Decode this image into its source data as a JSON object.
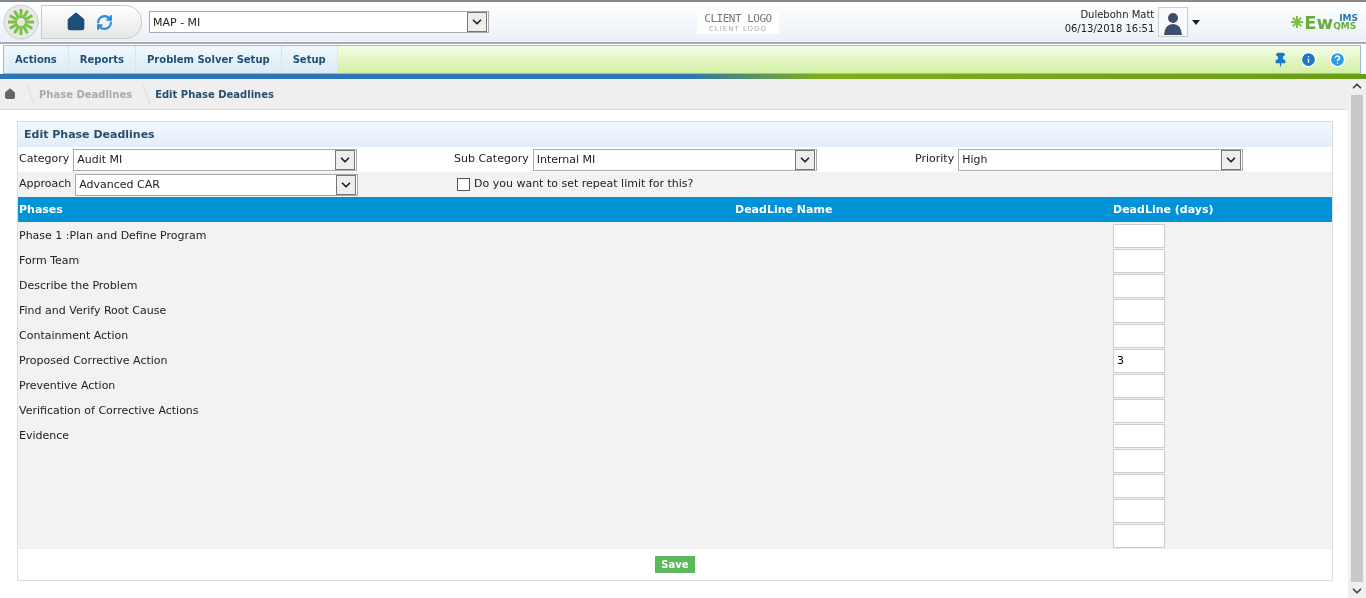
{
  "header": {
    "module_select": {
      "value": "MAP - MI"
    },
    "client_logo": {
      "title": "CLIENT LOGO",
      "subtitle": "CLIENT LOGO"
    },
    "user": {
      "name": "Dulebohn Matt",
      "datetime": "06/13/2018 16:51"
    },
    "brand": {
      "main": "Ew",
      "sub": "QMS",
      "sup": "IMS"
    }
  },
  "menu": [
    {
      "label": "Actions"
    },
    {
      "label": "Reports"
    },
    {
      "label": "Problem Solver Setup"
    },
    {
      "label": "Setup"
    }
  ],
  "breadcrumb": [
    {
      "label": "Phase Deadlines",
      "selected": false
    },
    {
      "label": "Edit Phase Deadlines",
      "selected": true
    }
  ],
  "panel": {
    "title": "Edit Phase Deadlines",
    "filters": [
      {
        "label": "Category",
        "value": "Audit MI"
      },
      {
        "label": "Sub Category",
        "value": "Internal MI"
      },
      {
        "label": "Priority",
        "value": "High"
      },
      {
        "label": "Approach",
        "value": "Advanced CAR"
      }
    ],
    "repeat_limit": {
      "label": "Do you want to set repeat limit for this?",
      "checked": false
    },
    "columns": [
      "Phases",
      "DeadLine Name",
      "DeadLine (days)"
    ],
    "rows": [
      {
        "kind": "phase",
        "phase": "Phase 1 :Plan and Define Program"
      },
      {
        "kind": "phase",
        "phase": "Form Team"
      },
      {
        "kind": "phase",
        "phase": "Describe the Problem"
      },
      {
        "kind": "phase",
        "phase": "Find and Verify Root Cause"
      },
      {
        "kind": "phase",
        "phase": "Containment Action"
      },
      {
        "kind": "phase",
        "phase": "Proposed Corrective Action",
        "deadline": "3"
      },
      {
        "kind": "phase",
        "phase": "Preventive Action"
      },
      {
        "kind": "phase",
        "phase": "Verification of Corrective Actions"
      },
      {
        "kind": "phase",
        "phase": "Evidence"
      },
      {
        "kind": "blank"
      },
      {
        "kind": "blank"
      },
      {
        "kind": "blank"
      },
      {
        "kind": "blank"
      }
    ],
    "save_button": "Save"
  }
}
